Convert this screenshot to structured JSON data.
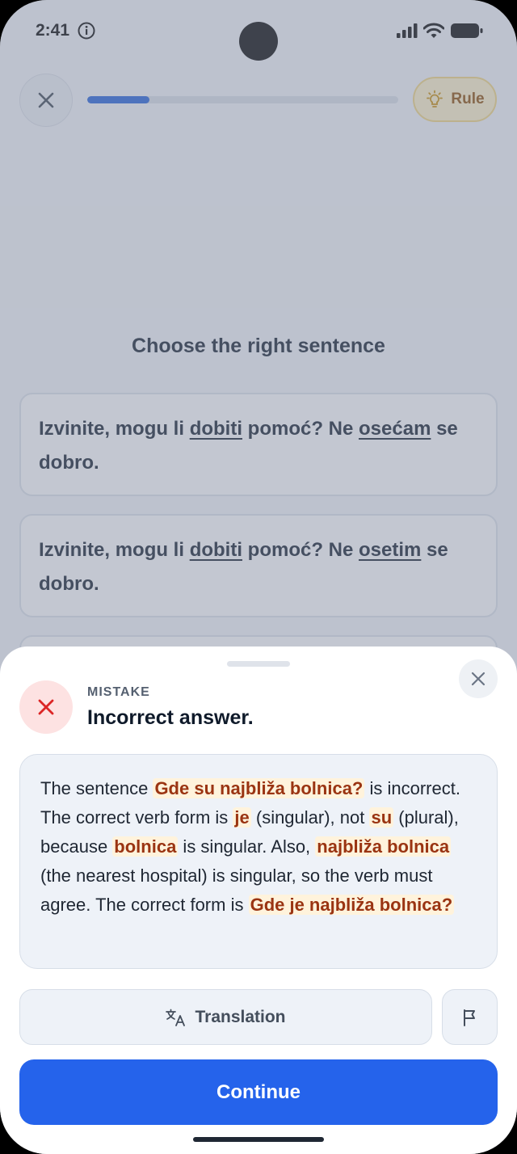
{
  "status_bar": {
    "time": "2:41"
  },
  "progress": {
    "fraction": 0.2
  },
  "topbar": {
    "rule_label": "Rule"
  },
  "question": {
    "title": "Choose the right sentence"
  },
  "options": [
    {
      "parts": [
        "Izvinite, mogu li ",
        "dobiti",
        " pomoć? Ne ",
        "osećam",
        " se dobro."
      ]
    },
    {
      "parts": [
        "Izvinite, mogu li ",
        "dobiti",
        " pomoć? Ne ",
        "osetim",
        " se dobro."
      ]
    }
  ],
  "feedback": {
    "label": "MISTAKE",
    "title": "Incorrect answer.",
    "explanation": {
      "t1": "The sentence ",
      "h1": "Gde su najbliža bolnica?",
      "t2": " is incorrect. The correct verb form is ",
      "h2": "je",
      "t3": " (singular), not ",
      "h3": "su",
      "t4": " (plural), because ",
      "h4": "bolnica",
      "t5": " is singular. Also, ",
      "h5": "najbliža bolnica",
      "t6": " (the nearest hospital) is singular, so the verb must agree. The correct form is ",
      "h6": "Gde je najbliža bolnica?"
    },
    "translation_label": "Translation",
    "continue_label": "Continue"
  },
  "colors": {
    "accent": "#2563eb",
    "progress": "#1f5fd9",
    "error": "#dc2626",
    "highlight_text": "#9a3412",
    "highlight_bg": "#fff3dc"
  }
}
